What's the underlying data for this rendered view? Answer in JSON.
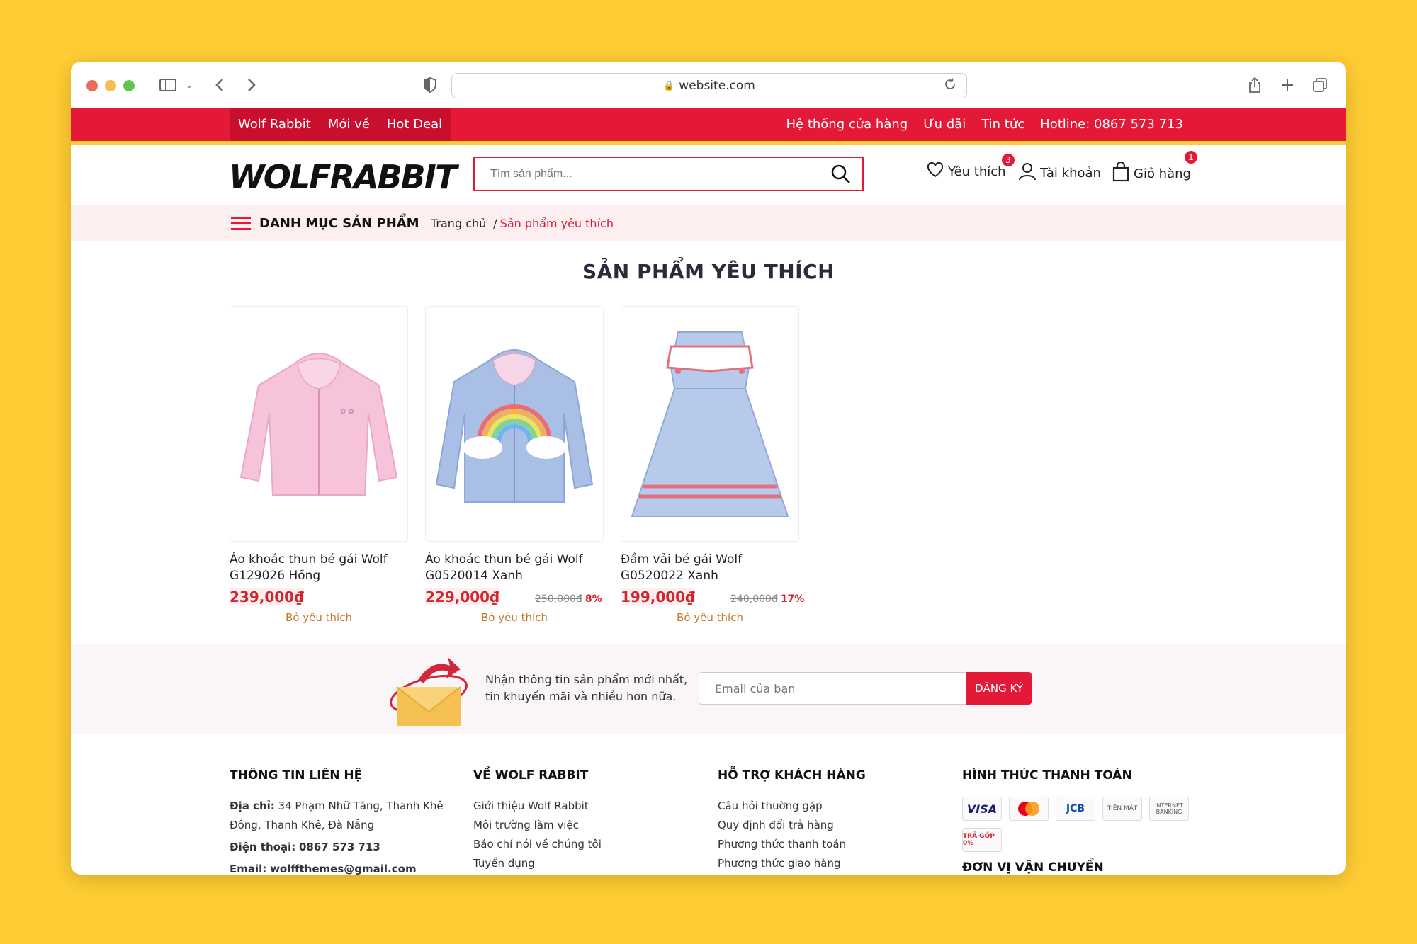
{
  "browser": {
    "url": "website.com"
  },
  "topbar": {
    "left": [
      "Wolf Rabbit",
      "Mới về",
      "Hot Deal"
    ],
    "right": [
      "Hệ thống cửa hàng",
      "Ưu đãi",
      "Tin tức",
      "Hotline: 0867 573 713"
    ]
  },
  "header": {
    "logo": "WOLFRABBIT",
    "search_placeholder": "Tìm sản phẩm...",
    "wishlist_label": "Yêu thích",
    "wishlist_count": "3",
    "account_label": "Tài khoản",
    "cart_label": "Giỏ hàng",
    "cart_count": "1"
  },
  "catbar": {
    "menu_label": "DANH MỤC SẢN PHẨM",
    "breadcrumb_home": "Trang chủ",
    "breadcrumb_sep": "/",
    "breadcrumb_current": "Sản phẩm yêu thích"
  },
  "page_title": "SẢN PHẨM YÊU THÍCH",
  "products": [
    {
      "name": "Áo khoác thun bé gái Wolf G129026 Hồng",
      "price": "239,000₫",
      "old_price": "",
      "discount": "",
      "remove": "Bỏ yêu thích",
      "color": "#F6C3DA"
    },
    {
      "name": "Áo khoác thun bé gái Wolf G0520014 Xanh",
      "price": "229,000₫",
      "old_price": "250,000₫",
      "discount": "8%",
      "remove": "Bỏ yêu thích",
      "color": "#A9BFE6"
    },
    {
      "name": "Đầm vải bé gái Wolf G0520022 Xanh",
      "price": "199,000₫",
      "old_price": "240,000₫",
      "discount": "17%",
      "remove": "Bỏ yêu thích",
      "color": "#B8CAEC"
    }
  ],
  "newsletter": {
    "text": "Nhận thông tin sản phẩm mới nhất, tin khuyến mãi và nhiều hơn nữa.",
    "placeholder": "Email của bạn",
    "button": "ĐĂNG KÝ"
  },
  "footer": {
    "contact": {
      "title": "THÔNG TIN LIÊN HỆ",
      "address_label": "Địa chỉ:",
      "address": "34 Phạm Nhữ Tăng, Thanh Khê Đông, Thanh Khê, Đà Nẵng",
      "phone_label": "Điện thoại:",
      "phone": "0867 573 713",
      "email_label": "Email:",
      "email": "wolffthemes@gmail.com"
    },
    "about": {
      "title": "VỀ WOLF RABBIT",
      "links": [
        "Giới thiệu Wolf Rabbit",
        "Môi trường làm việc",
        "Báo chí nói về chúng tôi",
        "Tuyển dụng"
      ]
    },
    "support": {
      "title": "HỖ TRỢ KHÁCH HÀNG",
      "links": [
        "Câu hỏi thường gặp",
        "Quy định đổi trả hàng",
        "Phương thức thanh toán",
        "Phương thức giao hàng"
      ]
    },
    "payment": {
      "title": "HÌNH THỨC THANH TOÁN",
      "methods": [
        "VISA",
        "MC",
        "JCB",
        "TIỀN MẶT",
        "INTERNET BANKING",
        "TRẢ GÓP 0%"
      ],
      "shipping_title": "ĐƠN VỊ VẬN CHUYỂN"
    }
  }
}
